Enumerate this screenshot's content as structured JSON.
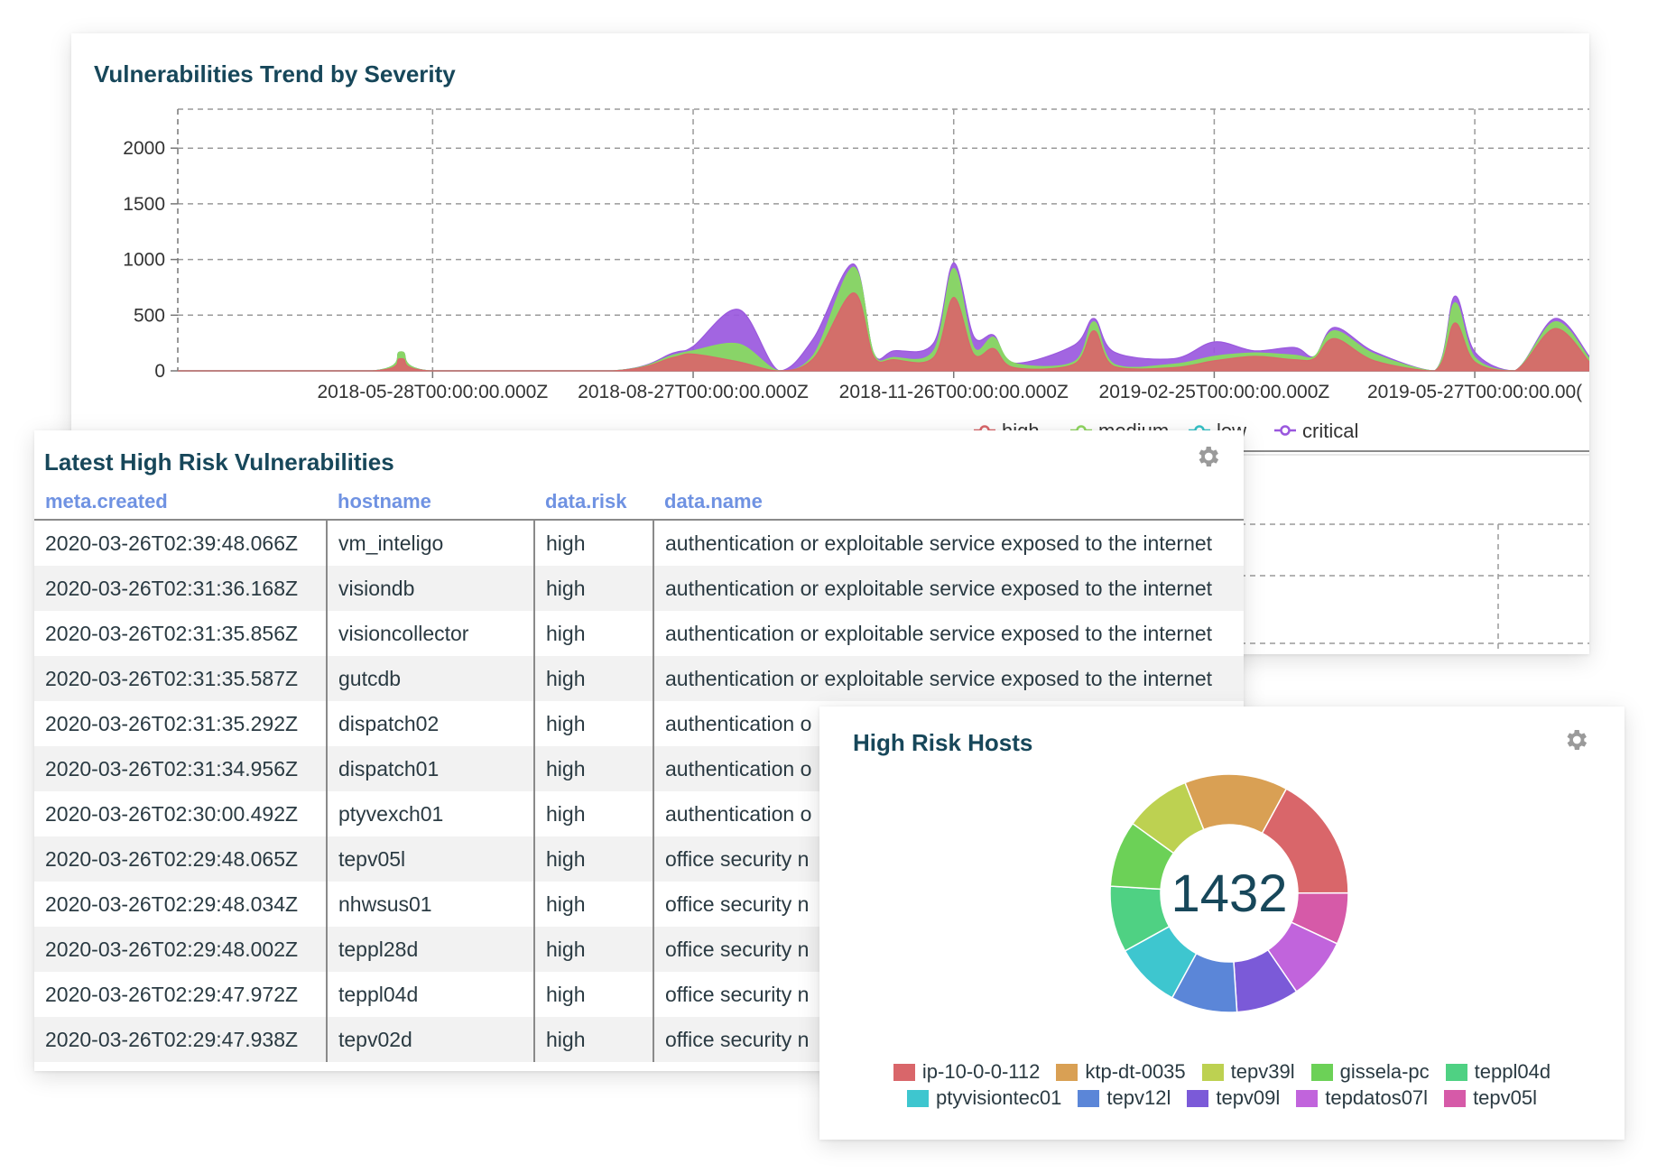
{
  "trend_panel": {
    "title": "Vulnerabilities Trend by Severity",
    "legend": [
      {
        "label": "high",
        "color": "#d9666a"
      },
      {
        "label": "medium",
        "color": "#8fd660"
      },
      {
        "label": "low",
        "color": "#35c2c7"
      },
      {
        "label": "critical",
        "color": "#9a58de"
      }
    ]
  },
  "chart_data": {
    "type": "area",
    "title": "Vulnerabilities Trend by Severity",
    "y_ticks": [
      0,
      500,
      1000,
      1500,
      2000
    ],
    "ylim": [
      0,
      2350
    ],
    "x_ticks": [
      "2018-05-28T00:00:00.000Z",
      "2018-08-27T00:00:00.000Z",
      "2018-11-26T00:00:00.000Z",
      "2019-02-25T00:00:00.000Z",
      "2019-05-27T00:00:00.00("
    ],
    "x_tick_dates": [
      "2018-05-28",
      "2018-08-27",
      "2018-11-26",
      "2019-02-25",
      "2019-05-27"
    ],
    "xlim": [
      "2018-02-28",
      "2019-07-06"
    ],
    "stacked": true,
    "grid": true,
    "legend_position": "bottom-right",
    "series": [
      {
        "name": "high",
        "x": [
          "2018-02-28",
          "2018-05-07",
          "2018-05-17",
          "2018-05-27",
          "2018-07-30",
          "2018-08-20",
          "2018-08-27",
          "2018-09-12",
          "2018-09-26",
          "2018-10-08",
          "2018-10-22",
          "2018-10-29",
          "2018-11-05",
          "2018-11-19",
          "2018-11-26",
          "2018-12-03",
          "2018-12-10",
          "2018-12-17",
          "2019-01-07",
          "2019-01-14",
          "2019-01-21",
          "2019-02-11",
          "2019-02-25",
          "2019-03-11",
          "2019-03-25",
          "2019-04-01",
          "2019-04-08",
          "2019-04-22",
          "2019-05-13",
          "2019-05-20",
          "2019-05-27",
          "2019-06-10",
          "2019-06-24",
          "2019-07-06"
        ],
        "values": [
          0,
          0,
          110,
          0,
          0,
          120,
          150,
          80,
          0,
          110,
          700,
          130,
          100,
          120,
          660,
          150,
          200,
          30,
          60,
          360,
          40,
          30,
          90,
          130,
          100,
          110,
          290,
          90,
          0,
          430,
          80,
          0,
          380,
          80
        ]
      },
      {
        "name": "medium",
        "x": [
          "2018-02-28",
          "2018-05-07",
          "2018-05-17",
          "2018-05-27",
          "2018-07-30",
          "2018-08-20",
          "2018-08-27",
          "2018-09-12",
          "2018-09-26",
          "2018-10-08",
          "2018-10-22",
          "2018-10-29",
          "2018-11-05",
          "2018-11-19",
          "2018-11-26",
          "2018-12-03",
          "2018-12-10",
          "2018-12-17",
          "2019-01-07",
          "2019-01-14",
          "2019-01-21",
          "2019-02-11",
          "2019-02-25",
          "2019-03-11",
          "2019-03-25",
          "2019-04-01",
          "2019-04-08",
          "2019-04-22",
          "2019-05-13",
          "2019-05-20",
          "2019-05-27",
          "2019-06-10",
          "2019-06-24",
          "2019-07-06"
        ],
        "values": [
          0,
          0,
          60,
          0,
          0,
          20,
          30,
          160,
          0,
          30,
          230,
          30,
          20,
          60,
          260,
          60,
          100,
          40,
          20,
          80,
          20,
          30,
          40,
          30,
          40,
          20,
          70,
          60,
          0,
          180,
          40,
          0,
          60,
          30
        ]
      },
      {
        "name": "low",
        "x": [
          "2018-02-28",
          "2018-05-07",
          "2018-05-17",
          "2018-05-27",
          "2018-07-30",
          "2018-08-20",
          "2018-08-27",
          "2018-09-12",
          "2018-09-26",
          "2018-10-08",
          "2018-10-22",
          "2018-10-29",
          "2018-11-05",
          "2018-11-19",
          "2018-11-26",
          "2018-12-03",
          "2018-12-10",
          "2018-12-17",
          "2019-01-07",
          "2019-01-14",
          "2019-01-21",
          "2019-02-11",
          "2019-02-25",
          "2019-03-11",
          "2019-03-25",
          "2019-04-01",
          "2019-04-08",
          "2019-04-22",
          "2019-05-13",
          "2019-05-20",
          "2019-05-27",
          "2019-06-10",
          "2019-06-24",
          "2019-07-06"
        ],
        "values": [
          0,
          0,
          0,
          0,
          0,
          0,
          0,
          0,
          0,
          0,
          0,
          0,
          0,
          0,
          0,
          0,
          0,
          0,
          0,
          0,
          0,
          0,
          0,
          0,
          0,
          0,
          0,
          0,
          0,
          0,
          0,
          0,
          0,
          0
        ]
      },
      {
        "name": "critical",
        "x": [
          "2018-02-28",
          "2018-05-07",
          "2018-05-17",
          "2018-05-27",
          "2018-07-30",
          "2018-08-20",
          "2018-08-27",
          "2018-09-12",
          "2018-09-26",
          "2018-10-08",
          "2018-10-22",
          "2018-10-29",
          "2018-11-05",
          "2018-11-19",
          "2018-11-26",
          "2018-12-03",
          "2018-12-10",
          "2018-12-17",
          "2019-01-07",
          "2019-01-14",
          "2019-01-21",
          "2019-02-11",
          "2019-02-25",
          "2019-03-11",
          "2019-03-25",
          "2019-04-01",
          "2019-04-08",
          "2019-04-22",
          "2019-05-13",
          "2019-05-20",
          "2019-05-27",
          "2019-06-10",
          "2019-06-24",
          "2019-07-06"
        ],
        "values": [
          0,
          0,
          0,
          0,
          0,
          20,
          40,
          310,
          0,
          150,
          30,
          0,
          60,
          70,
          50,
          100,
          20,
          0,
          150,
          30,
          110,
          50,
          130,
          20,
          70,
          0,
          30,
          20,
          0,
          60,
          50,
          0,
          30,
          20
        ]
      }
    ]
  },
  "table_panel": {
    "title": "Latest High Risk Vulnerabilities",
    "columns": [
      "meta.created",
      "hostname",
      "data.risk",
      "data.name"
    ],
    "rows": [
      [
        "2020-03-26T02:39:48.066Z",
        "vm_inteligo",
        "high",
        "authentication or exploitable service exposed to the internet"
      ],
      [
        "2020-03-26T02:31:36.168Z",
        "visiondb",
        "high",
        "authentication or exploitable service exposed to the internet"
      ],
      [
        "2020-03-26T02:31:35.856Z",
        "visioncollector",
        "high",
        "authentication or exploitable service exposed to the internet"
      ],
      [
        "2020-03-26T02:31:35.587Z",
        "gutcdb",
        "high",
        "authentication or exploitable service exposed to the internet"
      ],
      [
        "2020-03-26T02:31:35.292Z",
        "dispatch02",
        "high",
        "authentication o"
      ],
      [
        "2020-03-26T02:31:34.956Z",
        "dispatch01",
        "high",
        "authentication o"
      ],
      [
        "2020-03-26T02:30:00.492Z",
        "ptyvexch01",
        "high",
        "authentication o"
      ],
      [
        "2020-03-26T02:29:48.065Z",
        "tepv05l",
        "high",
        "office security n"
      ],
      [
        "2020-03-26T02:29:48.034Z",
        "nhwsus01",
        "high",
        "office security n"
      ],
      [
        "2020-03-26T02:29:48.002Z",
        "teppl28d",
        "high",
        "office security n"
      ],
      [
        "2020-03-26T02:29:47.972Z",
        "teppl04d",
        "high",
        "office security n"
      ],
      [
        "2020-03-26T02:29:47.938Z",
        "tepv02d",
        "high",
        "office security n"
      ]
    ]
  },
  "hosts_panel": {
    "title": "High Risk Hosts",
    "total": "1432",
    "hosts": [
      {
        "label": "ip-10-0-0-112",
        "color": "#d9666a",
        "share": 0.17
      },
      {
        "label": "tepv05l",
        "color": "#d65aa8",
        "share": 0.07
      },
      {
        "label": "tepdatos07l",
        "color": "#c164dc",
        "share": 0.085
      },
      {
        "label": "tepv09l",
        "color": "#7b5ad8",
        "share": 0.085
      },
      {
        "label": "tepv12l",
        "color": "#5b86d8",
        "share": 0.09
      },
      {
        "label": "ptyvisiontec01",
        "color": "#3ec6cf",
        "share": 0.09
      },
      {
        "label": "teppl04d",
        "color": "#4fd183",
        "share": 0.09
      },
      {
        "label": "gissela-pc",
        "color": "#6cd157",
        "share": 0.09
      },
      {
        "label": "tepv39l",
        "color": "#bdd151",
        "share": 0.09
      },
      {
        "label": "ktp-dt-0035",
        "color": "#d9a054",
        "share": 0.14
      }
    ],
    "legend_row1": [
      "ip-10-0-0-112",
      "ktp-dt-0035",
      "tepv39l",
      "gissela-pc",
      "teppl04d"
    ],
    "legend_row2": [
      "ptyvisiontec01",
      "tepv12l",
      "tepv09l",
      "tepdatos07l",
      "tepv05l"
    ]
  }
}
